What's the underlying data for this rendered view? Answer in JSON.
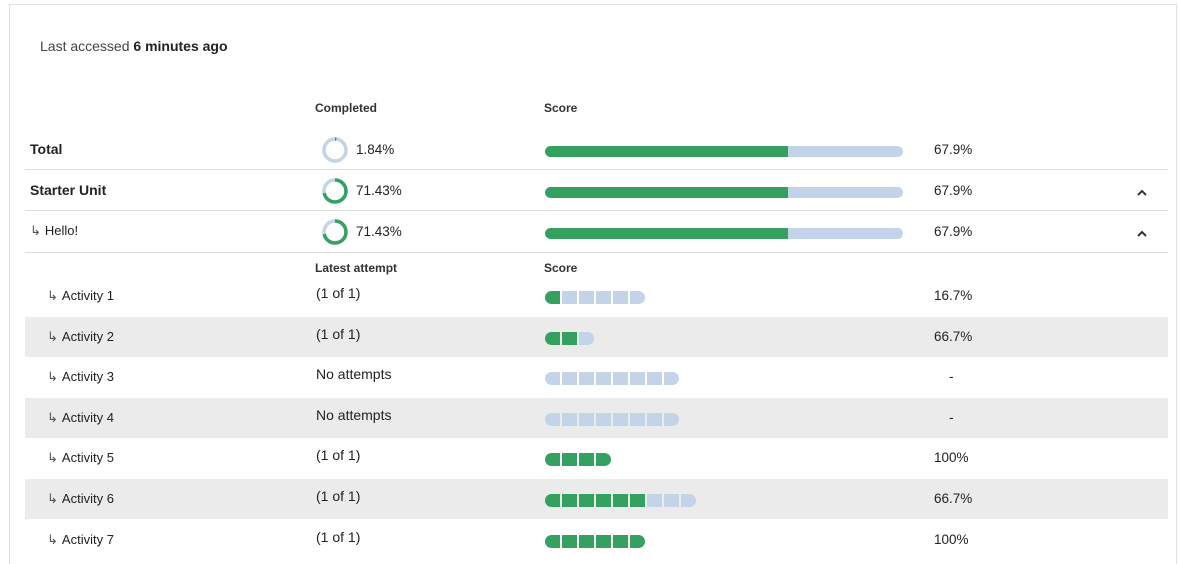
{
  "last_accessed": {
    "label": "Last accessed",
    "value": "6 minutes ago"
  },
  "headers": {
    "completed": "Completed",
    "score": "Score",
    "latest_attempt": "Latest attempt",
    "score2": "Score"
  },
  "arrow_glyph": "↳",
  "summary_rows": [
    {
      "name": "Total",
      "completed": "1.84%",
      "completed_fraction": 0.0184,
      "score": "67.9%",
      "score_fraction": 0.679,
      "expandable": false
    },
    {
      "name": "Starter Unit",
      "completed": "71.43%",
      "completed_fraction": 0.7143,
      "score": "67.9%",
      "score_fraction": 0.679,
      "expandable": true
    },
    {
      "name": "Hello!",
      "completed": "71.43%",
      "completed_fraction": 0.7143,
      "score": "67.9%",
      "score_fraction": 0.679,
      "expandable": true
    }
  ],
  "activities": [
    {
      "name": "Activity 1",
      "attempt": "(1 of 1)",
      "segments_total": 6,
      "segments_filled": 1,
      "score": "16.7%"
    },
    {
      "name": "Activity 2",
      "attempt": "(1 of 1)",
      "segments_total": 3,
      "segments_filled": 2,
      "score": "66.7%"
    },
    {
      "name": "Activity 3",
      "attempt": "No attempts",
      "segments_total": 8,
      "segments_filled": 0,
      "score": "-"
    },
    {
      "name": "Activity 4",
      "attempt": "No attempts",
      "segments_total": 8,
      "segments_filled": 0,
      "score": "-"
    },
    {
      "name": "Activity 5",
      "attempt": "(1 of 1)",
      "segments_total": 4,
      "segments_filled": 4,
      "score": "100%"
    },
    {
      "name": "Activity 6",
      "attempt": "(1 of 1)",
      "segments_total": 9,
      "segments_filled": 6,
      "score": "66.7%"
    },
    {
      "name": "Activity 7",
      "attempt": "(1 of 1)",
      "segments_total": 6,
      "segments_filled": 6,
      "score": "100%"
    }
  ],
  "colors": {
    "accent_green": "#34a160",
    "track_blue": "#c3d4e8",
    "row_shade": "#ebebeb"
  }
}
